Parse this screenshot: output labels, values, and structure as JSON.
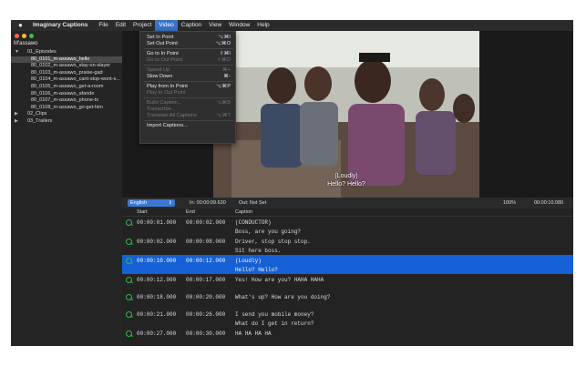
{
  "menubar": {
    "app_name": "Imaginary Captions",
    "items": [
      "File",
      "Edit",
      "Project",
      "Video",
      "Caption",
      "View",
      "Window",
      "Help"
    ],
    "active": "Video"
  },
  "sidebar": {
    "title": "M'assawo",
    "tree": [
      {
        "label": "01_Episodes",
        "level": 0,
        "expanded": true
      },
      {
        "label": "80_0101_m-assawo_hello",
        "level": 1,
        "selected": true
      },
      {
        "label": "80_0102_m-assawo_stay-on-slayer",
        "level": 1
      },
      {
        "label": "80_0103_m-assawo_praise-gad",
        "level": 1
      },
      {
        "label": "80_0104_m-assawo_cant-stop-wont-s...",
        "level": 1
      },
      {
        "label": "80_0105_m-assawo_get-a-room",
        "level": 1
      },
      {
        "label": "80_0106_m-assawo_afande",
        "level": 1
      },
      {
        "label": "80_0107_m-assawo_phone-tx",
        "level": 1
      },
      {
        "label": "80_0108_m-assawo_go-get-him",
        "level": 1
      },
      {
        "label": "02_Clips",
        "level": 0,
        "expanded": false
      },
      {
        "label": "03_Trailers",
        "level": 0,
        "expanded": false
      }
    ]
  },
  "video_menu": {
    "items": [
      {
        "label": "Set In Point",
        "shortcut": "⌥⌘I",
        "disabled": false
      },
      {
        "label": "Set Out Point",
        "shortcut": "⌥⌘O",
        "disabled": false
      },
      {
        "sep": true
      },
      {
        "label": "Go to In Point",
        "shortcut": "⇧⌘I",
        "disabled": false
      },
      {
        "label": "Go to Out Point",
        "shortcut": "⇧⌘O",
        "disabled": true
      },
      {
        "sep": true
      },
      {
        "label": "Speed Up",
        "shortcut": "⌘+",
        "disabled": true
      },
      {
        "label": "Slow Down",
        "shortcut": "⌘-",
        "disabled": false
      },
      {
        "sep": true
      },
      {
        "label": "Play from In Point",
        "shortcut": "⌥⌘P",
        "disabled": false
      },
      {
        "label": "Play to Out Point",
        "shortcut": "",
        "disabled": true
      },
      {
        "sep": true
      },
      {
        "label": "Build Caption...",
        "shortcut": "⌥⌘B",
        "disabled": true
      },
      {
        "label": "Transcribe...",
        "shortcut": "",
        "disabled": true
      },
      {
        "label": "Translate All Captions",
        "shortcut": "⌥⌘T",
        "disabled": true
      },
      {
        "sep": true
      },
      {
        "label": "Import Captions...",
        "shortcut": "",
        "disabled": false
      }
    ]
  },
  "video": {
    "caption_line1": "(Loudly)",
    "caption_line2": "Hello? Hello?"
  },
  "controls": {
    "language": "English",
    "in_point": "In: 00:00:09.630",
    "out_point": "Out: Not Set",
    "zoom": "100%",
    "timecode": "00:00:10.080"
  },
  "table": {
    "headers": {
      "start": "Start",
      "end": "End",
      "caption": "Caption"
    },
    "rows": [
      {
        "start": "00:00:01.000",
        "end": "00:00:02.000",
        "caption": "(CONDUCTOR)\nBoss, are you going?",
        "selected": false
      },
      {
        "start": "00:00:02.000",
        "end": "00:00:08.000",
        "caption": "Driver, stop stop stop.\nSit here boss.",
        "selected": false
      },
      {
        "start": "00:00:10.000",
        "end": "00:00:12.000",
        "caption": "(Loudly)\nHello? Hello?",
        "selected": true
      },
      {
        "start": "00:00:12.000",
        "end": "00:00:17.000",
        "caption": "Yes! How are you? HAHA HAHA",
        "selected": false
      },
      {
        "start": "00:00:18.000",
        "end": "00:00:20.000",
        "caption": "What's up? How are you doing?",
        "selected": false
      },
      {
        "start": "00:00:21.000",
        "end": "00:00:26.000",
        "caption": "I send you mobile money?\nWhat do I get in return?",
        "selected": false
      },
      {
        "start": "00:00:27.000",
        "end": "00:00:30.000",
        "caption": "HA HA HA HA",
        "selected": false
      }
    ]
  },
  "colors": {
    "accent": "#1560d4",
    "menu_active": "#3a73c8",
    "status_icon": "#2dbb4d"
  }
}
